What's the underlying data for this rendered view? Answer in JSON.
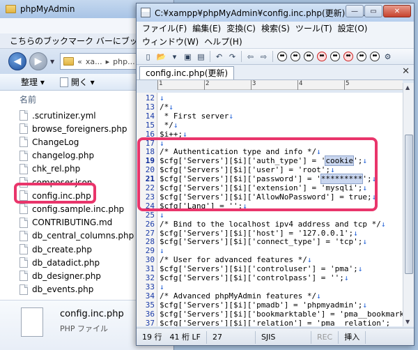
{
  "explorer": {
    "title": "phpMyAdmin",
    "bookmark_bar_text": "こちらのブックマーク バーにブック",
    "address": {
      "seg1": "«",
      "seg2": "xa...",
      "seg3": "php..."
    },
    "commands": {
      "organize": "整理 ▾",
      "open": "開く ▾"
    },
    "column_header": "名前",
    "files": [
      ".scrutinizer.yml",
      "browse_foreigners.php",
      "ChangeLog",
      "changelog.php",
      "chk_rel.php",
      "composer.json",
      "config.inc.php",
      "config.sample.inc.php",
      "CONTRIBUTING.md",
      "db_central_columns.php",
      "db_create.php",
      "db_datadict.php",
      "db_designer.php",
      "db_events.php"
    ],
    "details": {
      "name": "config.inc.php",
      "type": "PHP ファイル"
    }
  },
  "editor": {
    "title": "C:¥xampp¥phpMyAdmin¥config.inc.php(更新) - s...",
    "menu_row1": [
      "ファイル(F)",
      "編集(E)",
      "変換(C)",
      "検索(S)",
      "ツール(T)",
      "設定(O)"
    ],
    "menu_row2": [
      "ウィンドウ(W)",
      "ヘルプ(H)"
    ],
    "tab_label": "config.inc.php(更新)",
    "ruler_marks": [
      "1",
      "2",
      "3",
      "4",
      "5"
    ],
    "lines": [
      {
        "no": "12",
        "text": "↓"
      },
      {
        "no": "13",
        "text": "/*↓"
      },
      {
        "no": "14",
        "text": " * First server↓"
      },
      {
        "no": "15",
        "text": " */↓"
      },
      {
        "no": "16",
        "text": "$i++;↓"
      },
      {
        "no": "17",
        "text": "↓"
      },
      {
        "no": "18",
        "text": "/* Authentication type and info */↓"
      },
      {
        "no": "19",
        "text": "$cfg['Servers'][$i]['auth_type'] = 'cookie';↓"
      },
      {
        "no": "20",
        "text": "$cfg['Servers'][$i]['user'] = 'root';↓"
      },
      {
        "no": "21",
        "text": "$cfg['Servers'][$i]['password'] = '*********';↓"
      },
      {
        "no": "22",
        "text": "$cfg['Servers'][$i]['extension'] = 'mysqli';↓"
      },
      {
        "no": "23",
        "text": "$cfg['Servers'][$i]['AllowNoPassword'] = true;↓"
      },
      {
        "no": "24",
        "text": "$cfg['Lang'] = '';↓"
      },
      {
        "no": "25",
        "text": "↓"
      },
      {
        "no": "26",
        "text": "/* Bind to the localhost ipv4 address and tcp */↓"
      },
      {
        "no": "27",
        "text": "$cfg['Servers'][$i]['host'] = '127.0.0.1';↓"
      },
      {
        "no": "28",
        "text": "$cfg['Servers'][$i]['connect_type'] = 'tcp';↓"
      },
      {
        "no": "29",
        "text": "↓"
      },
      {
        "no": "30",
        "text": "/* User for advanced features */↓"
      },
      {
        "no": "31",
        "text": "$cfg['Servers'][$i]['controluser'] = 'pma';↓"
      },
      {
        "no": "32",
        "text": "$cfg['Servers'][$i]['controlpass'] = '';↓"
      },
      {
        "no": "33",
        "text": "↓"
      },
      {
        "no": "34",
        "text": "/* Advanced phpMyAdmin features */↓"
      },
      {
        "no": "35",
        "text": "$cfg['Servers'][$i]['pmadb'] = 'phpmyadmin';↓"
      },
      {
        "no": "36",
        "text": "$cfg['Servers'][$i]['bookmarktable'] = 'pma__bookmark'"
      },
      {
        "no": "37",
        "text": "$cfg['Servers'][$i]['relation'] = 'pma__relation';"
      }
    ],
    "status": {
      "position": "19 行　41 桁 LF",
      "code": "27",
      "encoding": "SJIS",
      "rec": "REC",
      "mode": "挿入"
    }
  },
  "colors": {
    "highlight": "#e9356b",
    "line_number": "#1a3aa8",
    "newline_mark": "#1f5fd6"
  }
}
